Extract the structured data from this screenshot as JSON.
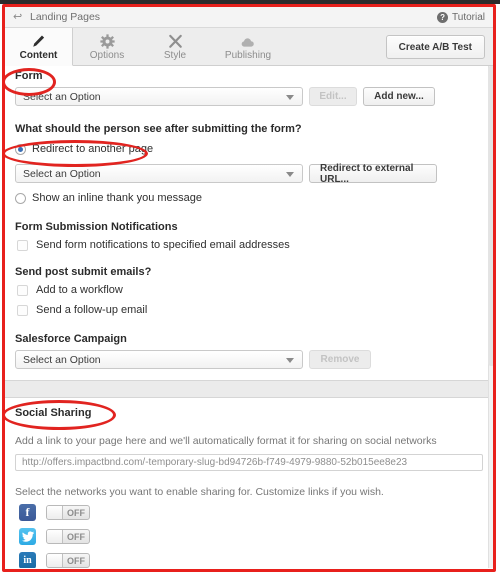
{
  "window": {
    "breadcrumb": "Landing Pages",
    "back_icon": "back-arrow-icon",
    "tutorial_label": "Tutorial",
    "tutorial_icon": "question-circle-icon"
  },
  "tabs": {
    "items": [
      {
        "label": "Content",
        "icon": "pencil-icon",
        "active": true
      },
      {
        "label": "Options",
        "icon": "gear-icon",
        "active": false
      },
      {
        "label": "Style",
        "icon": "scissors-x-icon",
        "active": false
      },
      {
        "label": "Publishing",
        "icon": "cloud-icon",
        "active": false
      }
    ],
    "ab_test_button": "Create A/B Test"
  },
  "form_section": {
    "title": "Form",
    "select_value": "Select an Option",
    "edit_button": "Edit...",
    "edit_disabled": true,
    "add_new_button": "Add new...",
    "question": "What should the person see after submitting the form?",
    "radio_redirect": "Redirect to another page",
    "radio_redirect_selected": true,
    "redirect_select_value": "Select an Option",
    "redirect_external_button": "Redirect to external URL...",
    "radio_inline": "Show an inline thank you message",
    "radio_inline_selected": false,
    "notifications_title": "Form Submission Notifications",
    "notifications_option": "Send form notifications to specified email addresses",
    "post_submit_title": "Send post submit emails?",
    "post_submit_options": [
      "Add to a workflow",
      "Send a follow-up email"
    ],
    "salesforce_title": "Salesforce Campaign",
    "salesforce_select_value": "Select an Option",
    "salesforce_remove_button": "Remove",
    "salesforce_remove_disabled": true
  },
  "social_section": {
    "title": "Social Sharing",
    "helper": "Add a link to your page here and we'll automatically format it for sharing on social networks",
    "url_value": "http://offers.impactbnd.com/-temporary-slug-bd94726b-f749-4979-9880-52b015ee8e23",
    "networks_helper": "Select the networks you want to enable sharing for. Customize links if you wish.",
    "networks": [
      {
        "name": "Facebook",
        "icon": "facebook-icon",
        "glyph": "f",
        "state": "OFF"
      },
      {
        "name": "Twitter",
        "icon": "twitter-icon",
        "glyph": "t",
        "state": "OFF"
      },
      {
        "name": "LinkedIn",
        "icon": "linkedin-icon",
        "glyph": "in",
        "state": "OFF"
      }
    ]
  },
  "colors": {
    "annotation": "#e12420",
    "radio_selected": "#3b6fb6",
    "facebook": "#3b5998",
    "twitter": "#2daae4",
    "linkedin": "#1a6ba3"
  }
}
